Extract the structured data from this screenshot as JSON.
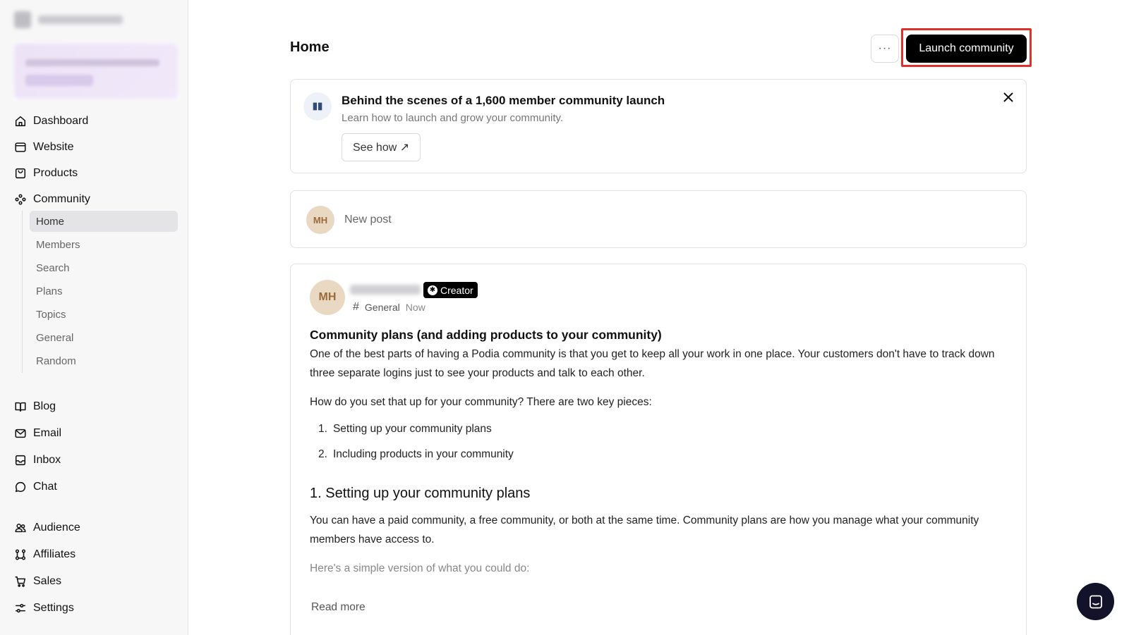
{
  "sidebar": {
    "nav_top": [
      {
        "label": "Dashboard",
        "icon": "home-icon"
      },
      {
        "label": "Website",
        "icon": "browser-icon"
      },
      {
        "label": "Products",
        "icon": "bag-icon"
      },
      {
        "label": "Community",
        "icon": "community-icon"
      }
    ],
    "community_sub": [
      "Home",
      "Members",
      "Search",
      "Plans",
      "Topics",
      "General",
      "Random"
    ],
    "active_sub": "Home",
    "nav_mid": [
      {
        "label": "Blog",
        "icon": "book-icon"
      },
      {
        "label": "Email",
        "icon": "mail-icon"
      },
      {
        "label": "Inbox",
        "icon": "inbox-icon"
      },
      {
        "label": "Chat",
        "icon": "chat-bubble-icon"
      }
    ],
    "nav_bottom": [
      {
        "label": "Audience",
        "icon": "users-icon"
      },
      {
        "label": "Affiliates",
        "icon": "affiliates-icon"
      },
      {
        "label": "Sales",
        "icon": "cart-icon"
      },
      {
        "label": "Settings",
        "icon": "sliders-icon"
      }
    ]
  },
  "header": {
    "title": "Home",
    "more_label": "···",
    "launch_label": "Launch community"
  },
  "banner": {
    "title": "Behind the scenes of a 1,600 member community launch",
    "subtitle": "Learn how to launch and grow your community.",
    "button": "See how ↗"
  },
  "new_post": {
    "avatar": "MH",
    "label": "New post"
  },
  "post": {
    "avatar": "MH",
    "badge": "Creator",
    "topic": "General",
    "time": "Now",
    "title": "Community plans (and adding products to your community)",
    "p1": "One of the best parts of having a Podia community is that you get to keep all your work in one place. Your customers don't have to track down three separate logins just to see your products and talk to each other.",
    "p2": "How do you set that up for your community? There are two key pieces:",
    "list": [
      {
        "num": "1.",
        "text": "Setting up your community plans"
      },
      {
        "num": "2.",
        "text": "Including products in your community"
      }
    ],
    "h2": "1. Setting up your community plans",
    "p3": "You can have a paid community, a free community, or both at the same time. Community plans are how you manage what your community members have access to.",
    "p4": "Here's a simple version of what you could do:",
    "read_more": "Read more"
  }
}
